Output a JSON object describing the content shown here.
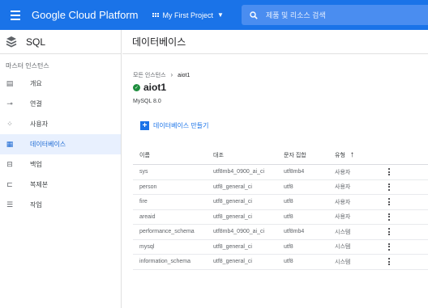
{
  "topbar": {
    "brand": "Google Cloud Platform",
    "project_name": "My First Project",
    "search_placeholder": "제품 및 리소스 검색"
  },
  "sidenav": {
    "title": "SQL",
    "section": "마스터 인스턴스",
    "items": [
      {
        "label": "개요",
        "icon": "overview-icon"
      },
      {
        "label": "연결",
        "icon": "connections-icon"
      },
      {
        "label": "사용자",
        "icon": "users-icon"
      },
      {
        "label": "데이터베이스",
        "icon": "databases-icon",
        "active": true
      },
      {
        "label": "백업",
        "icon": "backups-icon"
      },
      {
        "label": "복제본",
        "icon": "replicas-icon"
      },
      {
        "label": "작업",
        "icon": "operations-icon"
      }
    ]
  },
  "main": {
    "page_title": "데이터베이스",
    "breadcrumb": {
      "root": "모든 인스턴스",
      "current": "aiot1"
    },
    "instance_name": "aiot1",
    "version": "MySQL 8.0",
    "create_button": "데이터베이스 만들기",
    "table": {
      "headers": [
        "이름",
        "대조",
        "문자 집합",
        "유형"
      ],
      "sort_column": "유형",
      "sort_direction": "ascending",
      "rows": [
        [
          "sys",
          "utf8mb4_0900_ai_ci",
          "utf8mb4",
          "사용자"
        ],
        [
          "person",
          "utf8_general_ci",
          "utf8",
          "사용자"
        ],
        [
          "fire",
          "utf8_general_ci",
          "utf8",
          "사용자"
        ],
        [
          "areaid",
          "utf8_general_ci",
          "utf8",
          "사용자"
        ],
        [
          "performance_schema",
          "utf8mb4_0900_ai_ci",
          "utf8mb4",
          "시스템"
        ],
        [
          "mysql",
          "utf8_general_ci",
          "utf8",
          "시스템"
        ],
        [
          "information_schema",
          "utf8_general_ci",
          "utf8",
          "시스템"
        ]
      ]
    }
  },
  "colors": {
    "topbar": "#1a73e8",
    "active_nav_bg": "#e8f0fe",
    "active_nav_text": "#1967d2",
    "status_ok": "#1e8e3e"
  }
}
